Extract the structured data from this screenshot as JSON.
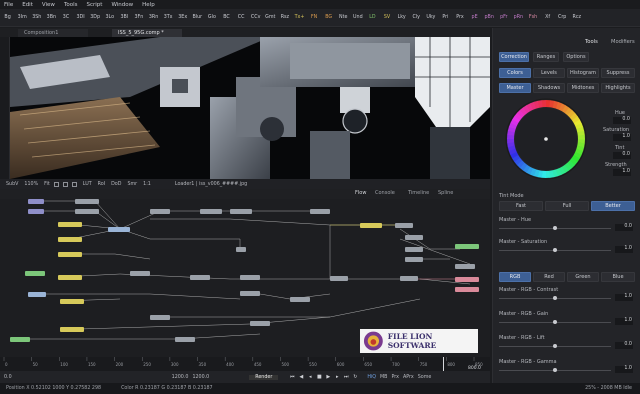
{
  "menu": [
    "File",
    "Edit",
    "View",
    "Tools",
    "Script",
    "Window",
    "Help"
  ],
  "toolbar": [
    "Bg",
    "3Im",
    "3Sh",
    "3Bn",
    "3C",
    "3DI",
    "3Dp",
    "3Lo",
    "3Bl",
    "3Fn",
    "3Rn",
    "3Tx",
    "3Ex",
    "Blur",
    "Glo",
    "BC",
    "CC",
    "CCv",
    "Gmt",
    "Rsz",
    "Tx+",
    "FN",
    "BG",
    "Nte",
    "Und",
    "LD",
    "SV",
    "Lky",
    "Cly",
    "Uky",
    "Pri",
    "Prx",
    "pE",
    "pBn",
    "pFr",
    "pRn",
    "Fsh",
    "Xf",
    "Crp",
    "Rcz"
  ],
  "viewer": {
    "tabs": [
      "Composition1",
      "ISS_5_95G.comp *"
    ],
    "status_left": [
      "SubV",
      "110%",
      "Fit",
      "LUT",
      "RoI",
      "DoD",
      "Smr",
      "1:1"
    ],
    "status_right": "Loader1 | iss_v006_####.jpg"
  },
  "flow": {
    "tabs": [
      "Flow",
      "Console",
      "Timeline",
      "Spline"
    ]
  },
  "timeline": {
    "ticks": [
      "0",
      "50",
      "100",
      "150",
      "200",
      "250",
      "300",
      "350",
      "400",
      "450",
      "500",
      "550",
      "600",
      "650",
      "700",
      "750",
      "800",
      "850"
    ],
    "current_frame": "800.0"
  },
  "transport": {
    "start": "0.0",
    "in": "1200.0",
    "out": "1200.0",
    "render": "Render",
    "buttons": [
      "HiQ",
      "MB",
      "Prx",
      "APrx",
      "Some"
    ],
    "frame": "800.0"
  },
  "statusbar": {
    "position": "Position  X 0.52102   1000   Y 0.27582   298",
    "color": "Color  R 0.23187   G 0.23187   B 0.23187",
    "right": "25% - 2008 MB   Idle"
  },
  "panel": {
    "tabs": [
      "Tools",
      "Modifiers"
    ],
    "subtabs": [
      "Correction",
      "Ranges",
      "Options"
    ],
    "modes": [
      "Colors",
      "Levels",
      "Histogram",
      "Suppress"
    ],
    "ranges": [
      "Master",
      "Shadows",
      "Midtones",
      "Highlights"
    ],
    "wheel_fields": [
      {
        "label": "Hue",
        "value": "0.0"
      },
      {
        "label": "Saturation",
        "value": "1.0"
      },
      {
        "label": "Tint",
        "value": "0.0"
      },
      {
        "label": "Strength",
        "value": "1.0"
      }
    ],
    "tint_mode": "Tint Mode",
    "tint_options": [
      "Fast",
      "Full",
      "Better"
    ],
    "sliders_top": [
      {
        "label": "Master - Hue",
        "value": "0.0"
      },
      {
        "label": "Master - Saturation",
        "value": "1.0"
      }
    ],
    "channels": [
      "RGB",
      "Red",
      "Green",
      "Blue"
    ],
    "sliders_bottom": [
      {
        "label": "Master - RGB - Contrast",
        "value": "1.0"
      },
      {
        "label": "Master - RGB - Gain",
        "value": "1.0"
      },
      {
        "label": "Master - RGB - Lift",
        "value": "0.0"
      },
      {
        "label": "Master - RGB - Gamma",
        "value": "1.0"
      }
    ]
  },
  "watermark": "FILE LION SOFTWARE",
  "colors": {
    "accent": "#3d5f94",
    "node_yellow": "#d6c95a",
    "node_green": "#7cc67a"
  }
}
